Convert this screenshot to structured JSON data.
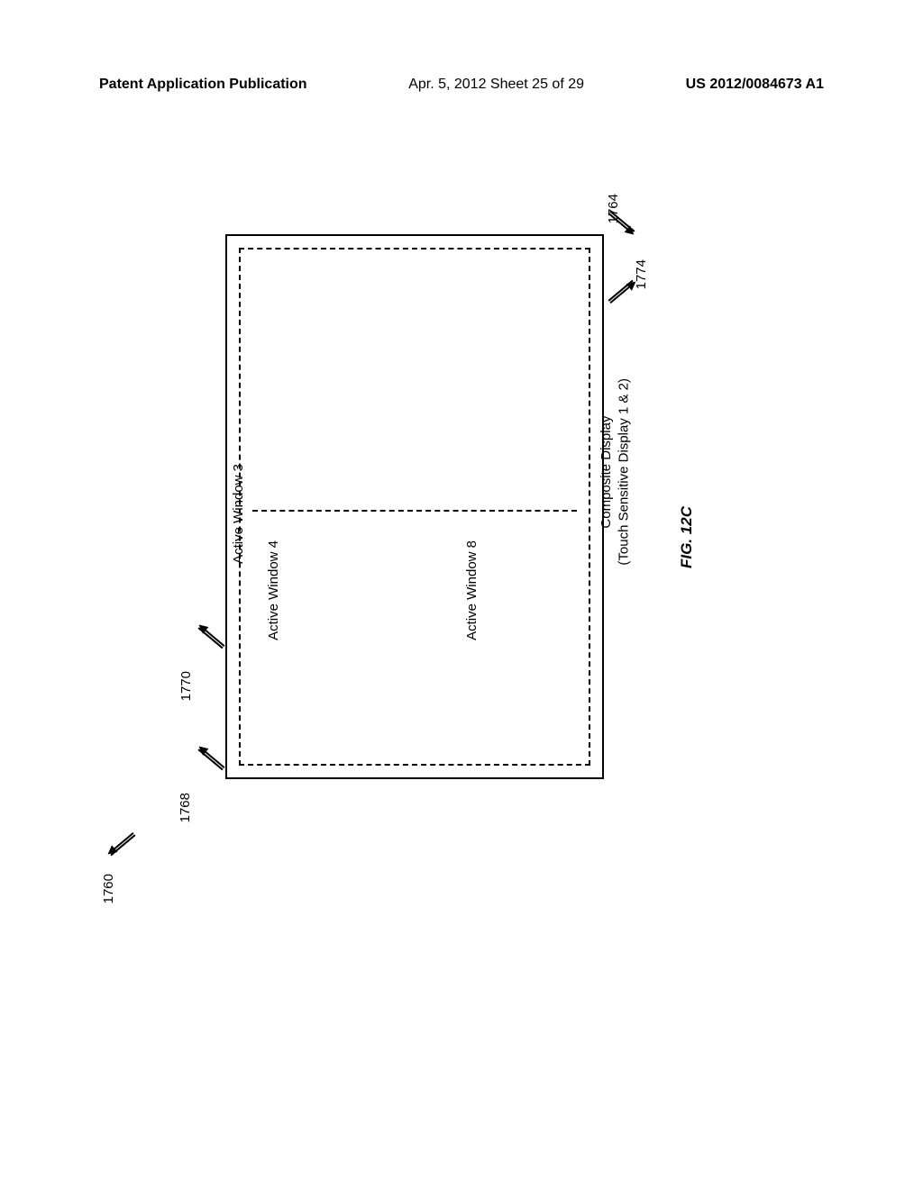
{
  "header": {
    "left": "Patent Application Publication",
    "center": "Apr. 5, 2012  Sheet 25 of 29",
    "right": "US 2012/0084673 A1"
  },
  "refs": {
    "r1760": "1760",
    "r1764": "1764",
    "r1768": "1768",
    "r1770": "1770",
    "r1774": "1774"
  },
  "labels": {
    "composite_line1": "Composite Display",
    "composite_line2": "(Touch Sensitive Display 1 & 2)",
    "window3": "Active Window 3",
    "window4": "Active Window 4",
    "window8": "Active Window 8",
    "figure": "FIG. 12C"
  }
}
